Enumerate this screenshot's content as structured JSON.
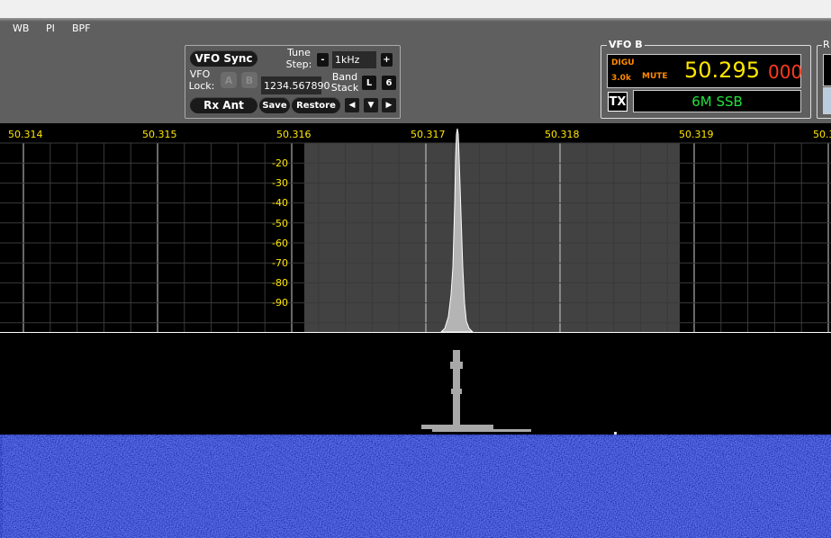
{
  "menu": [
    "WB",
    "PI",
    "BPF"
  ],
  "controls": {
    "vfo_sync": "VFO Sync",
    "tune_step_label_1": "Tune",
    "tune_step_label_2": "Step:",
    "minus": "-",
    "tune_step_value": "1kHz",
    "plus": "+",
    "vfo_lock_label_1": "VFO",
    "vfo_lock_label_2": "Lock:",
    "lock_a": "A",
    "lock_b": "B",
    "freq_entry": "1234.567890",
    "band_stack_label_1": "Band",
    "band_stack_label_2": "Stack",
    "band_l": "L",
    "band_6": "6",
    "rx_ant": "Rx Ant",
    "save": "Save",
    "restore": "Restore"
  },
  "vfo_b": {
    "title": "VFO B",
    "mode": "DIGU",
    "filter": "3.0k",
    "mute": "MUTE",
    "freq_main": "50.295",
    "freq_sub": "000",
    "tx": "TX",
    "band_mode": "6M SSB"
  },
  "right_panel": {
    "title": "R"
  },
  "spectrum": {
    "freq_ticks": [
      "50.314",
      "50.315",
      "50.316",
      "50.317",
      "50.318",
      "50.319",
      "50.3"
    ],
    "db_ticks": [
      "-20",
      "-30",
      "-40",
      "-50",
      "-60",
      "-70",
      "-80",
      "-90"
    ]
  },
  "colors": {
    "toolbar": "#5f5f5f",
    "freq_yellow": "#ffe600",
    "sub_red": "#ff3b1f",
    "mode_green": "#22e03a",
    "waterfall_blue": "#1a2aa8"
  }
}
